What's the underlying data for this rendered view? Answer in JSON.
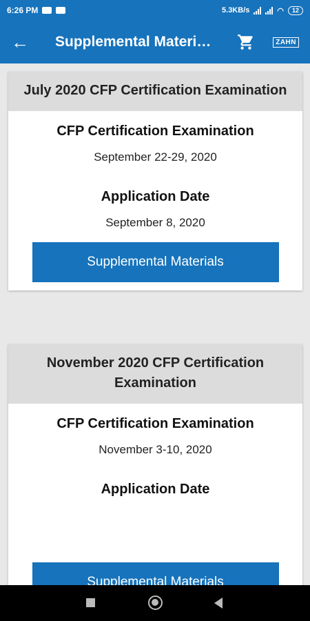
{
  "status_bar": {
    "time": "6:26 PM",
    "speed": "5.3KB/s",
    "battery": "12"
  },
  "app_bar": {
    "title": "Supplemental Materials",
    "logo_text": "ZAHN"
  },
  "cards": [
    {
      "header": "July 2020 CFP Certification Examination",
      "exam_label": "CFP Certification Examination",
      "exam_date": "September 22-29, 2020",
      "application_label": "Application Date",
      "application_date": "September 8, 2020",
      "button_label": "Supplemental Materials"
    },
    {
      "header": "November 2020 CFP Certification Examination",
      "exam_label": "CFP Certification Examination",
      "exam_date": "November 3-10, 2020",
      "application_label": "Application Date",
      "application_date": "",
      "button_label": "Supplemental Materials"
    }
  ],
  "colors": {
    "primary": "#1673bc",
    "card_header_bg": "#dcdcdc",
    "page_bg": "#e8e8e8"
  }
}
